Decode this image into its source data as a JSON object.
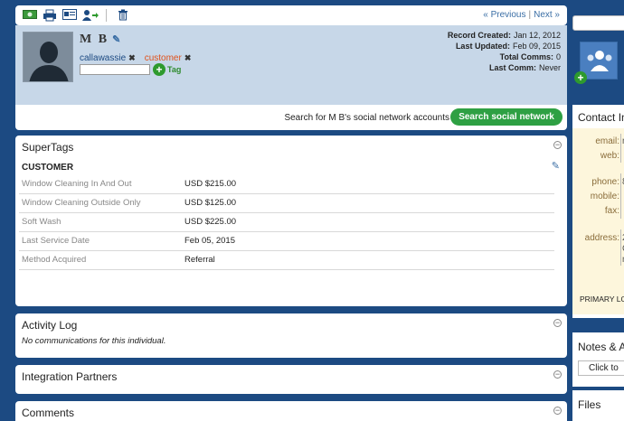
{
  "toolbar": {
    "icons": [
      "money-icon",
      "print-icon",
      "card-icon",
      "user-move-icon",
      "trash-icon"
    ],
    "prev_label": "« Previous",
    "separator": "|",
    "next_label": "Next »"
  },
  "contact": {
    "name": "M B",
    "tags": [
      {
        "label": "callawassie",
        "color": "#1c4a82"
      },
      {
        "label": "customer",
        "color": "#e0521c"
      }
    ],
    "add_tag_label": "Tag",
    "meta": [
      {
        "key": "Record Created:",
        "value": "Jan 12, 2012"
      },
      {
        "key": "Last Updated:",
        "value": "Feb 09, 2015"
      },
      {
        "key": "Total Comms:",
        "value": "0"
      },
      {
        "key": "Last Comm:",
        "value": "Never"
      }
    ]
  },
  "social": {
    "text": "Search for M B's social network accounts",
    "button_label": "Search social network"
  },
  "supertags": {
    "title": "SuperTags",
    "group": "CUSTOMER",
    "rows": [
      {
        "key": "Window Cleaning In And Out",
        "value": "USD $215.00"
      },
      {
        "key": "Window Cleaning Outside Only",
        "value": "USD $125.00"
      },
      {
        "key": "Soft Wash",
        "value": "USD $225.00"
      },
      {
        "key": "Last Service Date",
        "value": "Feb 05, 2015"
      },
      {
        "key": "Method Acquired",
        "value": "Referral"
      }
    ]
  },
  "activity": {
    "title": "Activity Log",
    "body": "No communications for this individual."
  },
  "integration": {
    "title": "Integration Partners"
  },
  "comments": {
    "title": "Comments"
  },
  "sidebar": {
    "contact_title": "Contact In",
    "fields": [
      {
        "key": "email:",
        "value": "r"
      },
      {
        "key": "web:",
        "value": ""
      },
      {
        "key": "phone:",
        "value": "8"
      },
      {
        "key": "mobile:",
        "value": ""
      },
      {
        "key": "fax:",
        "value": ""
      },
      {
        "key": "address:",
        "value": "2"
      }
    ],
    "address_extra": [
      "C",
      "n"
    ],
    "primary_label": "PRIMARY LO",
    "notes_title": "Notes & A",
    "notes_button": "Click to",
    "files_title": "Files"
  },
  "colors": {
    "background": "#1c4a82",
    "header": "#c7d7e8",
    "accent_green": "#2ea043",
    "link_blue": "#3a6ea5"
  }
}
